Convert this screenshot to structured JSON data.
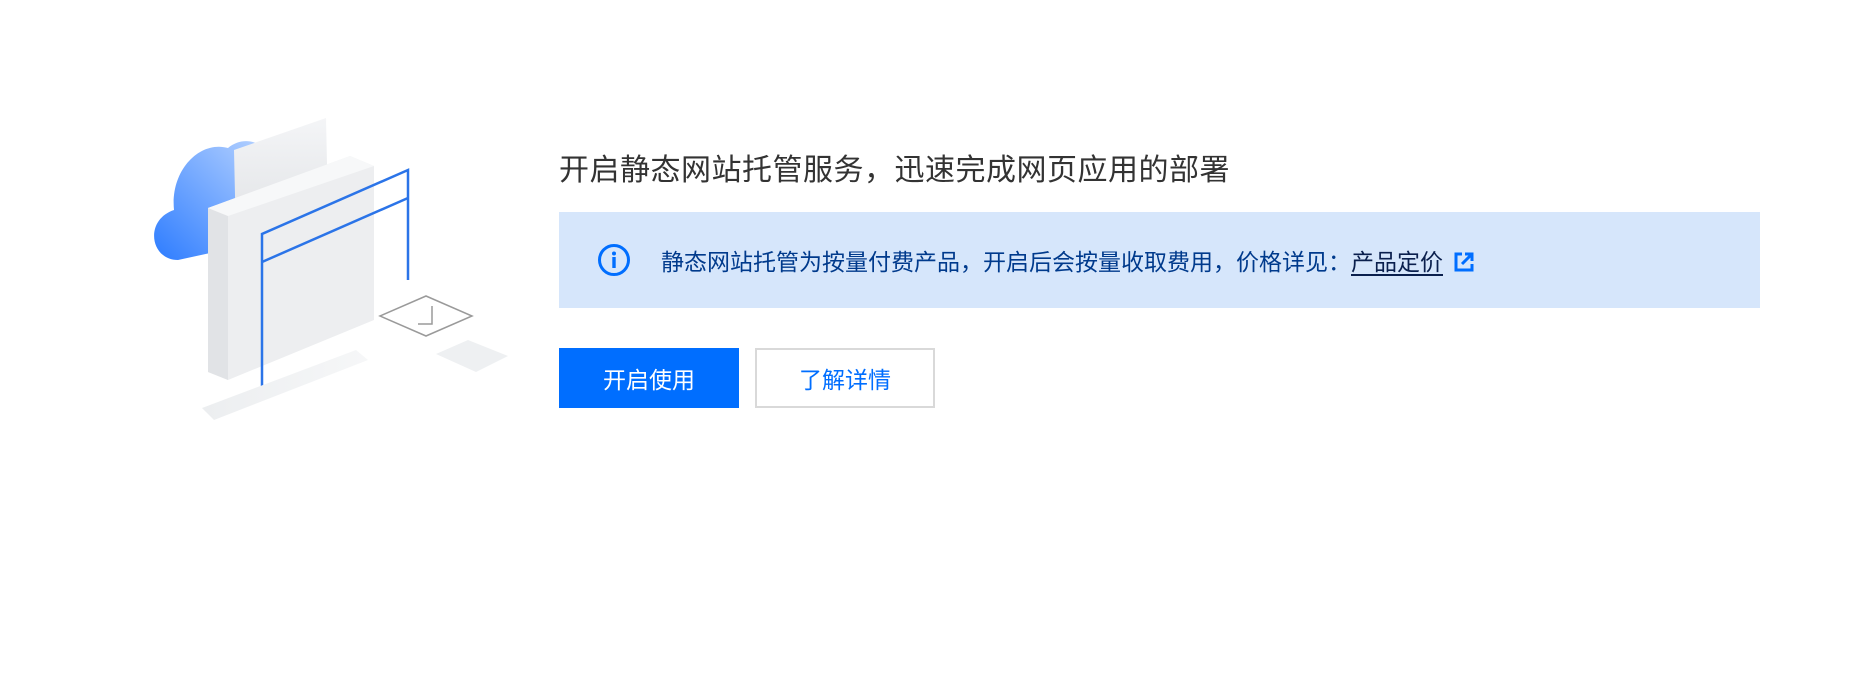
{
  "headline": "开启静态网站托管服务，迅速完成网页应用的部署",
  "notice": {
    "text": "静态网站托管为按量付费产品，开启后会按量收取费用，价格详见：",
    "link_label": "产品定价",
    "icon": "info-icon",
    "link_icon": "external-link-icon"
  },
  "actions": {
    "primary_label": "开启使用",
    "secondary_label": "了解详情"
  },
  "colors": {
    "primary": "#006eff",
    "notice_bg": "#d6e6fb",
    "notice_text": "#003a8c",
    "headline": "#333333"
  }
}
